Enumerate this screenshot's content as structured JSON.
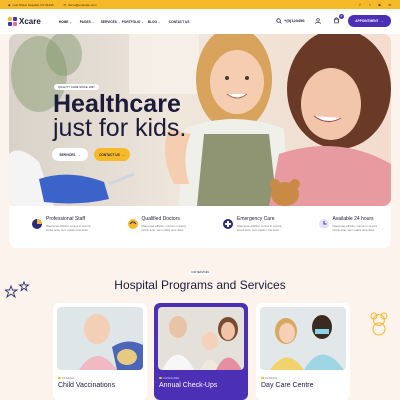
{
  "colors": {
    "accent": "#4b2fb5",
    "yellow": "#f6b928",
    "background": "#fbf3ec"
  },
  "topbar": {
    "address": "Low Street Hospital, NY 01234",
    "email": "demo@example.com",
    "social": [
      "facebook-icon",
      "twitter-icon",
      "youtube-icon",
      "linkedin-icon"
    ]
  },
  "header": {
    "logo_text": "Xcare",
    "nav": [
      {
        "label": "HOME"
      },
      {
        "label": "PAGES"
      },
      {
        "label": "SERVICES"
      },
      {
        "label": "PORTFOLIO"
      },
      {
        "label": "BLOG"
      },
      {
        "label": "CONTACT US"
      }
    ],
    "phone": "+(0)123456",
    "cart_count": "0",
    "appointment_label": "APPOINTMENT"
  },
  "hero": {
    "badge": "QUALITY CARE SINCE 1997",
    "title_line1": "Healthcare",
    "title_line2": "just for kids.",
    "services_button": "SERVICES",
    "contact_button": "CONTACT US"
  },
  "features": [
    {
      "title": "Professional Staff",
      "desc": "Maecenas efficitur, cursus in viverra luctus ante, sem mattis urna dolor."
    },
    {
      "title": "Qualified Doctors",
      "desc": "Maecenas efficitur, cursus in viverra luctus ante, sem mattis urna dolor."
    },
    {
      "title": "Emergency Care",
      "desc": "Maecenas efficitur, cursus in viverra luctus ante, sem mattis urna dolor."
    },
    {
      "title": "Available 24 hours",
      "desc": "Maecenas efficitur, cursus in viverra luctus ante, sem mattis urna dolor."
    }
  ],
  "services": {
    "tag": "OUR SERVICES",
    "title": "Hospital Programs and Services",
    "cards": [
      {
        "category": "CLINICAL",
        "title": "Child Vaccinations",
        "active": false
      },
      {
        "category": "CHILDCARE",
        "title": "Annual Check-Ups",
        "active": true
      },
      {
        "category": "CLINICAL",
        "title": "Day Care Centre",
        "active": false
      }
    ]
  }
}
